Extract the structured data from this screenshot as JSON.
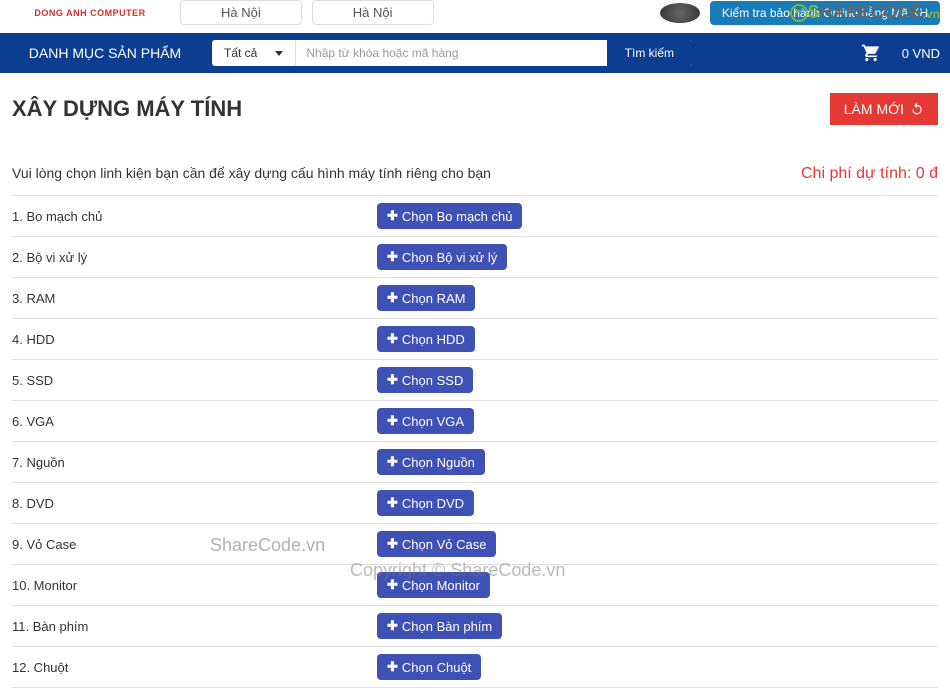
{
  "header": {
    "logo_text": "DONG ANH COMPUTER",
    "location1": "Hà Nội",
    "location2": "Hà Nội",
    "warranty_button": "Kiểm tra bảo hành Online bằng Mã KH"
  },
  "nav": {
    "category_label": "DANH MỤC SẢN PHẨM",
    "search_category": "Tất cả",
    "search_placeholder": "Nhập từ khóa hoặc mã hàng",
    "search_button": "Tìm kiếm",
    "cart_total": "0 VND"
  },
  "page": {
    "title": "XÂY DỰNG MÁY TÍNH",
    "reset_button": "LÀM MỚI",
    "instruction": "Vui lòng chọn linh kiện bạn cần để xây dựng cấu hình máy tính riêng cho bạn",
    "cost_label": "Chi phí dự tính: 0 đ"
  },
  "components": [
    {
      "index": "1.",
      "name": "Bo mạch chủ",
      "button": "Chọn Bo mạch chủ"
    },
    {
      "index": "2.",
      "name": "Bộ vi xử lý",
      "button": "Chọn Bộ vi xử lý"
    },
    {
      "index": "3.",
      "name": "RAM",
      "button": "Chọn RAM"
    },
    {
      "index": "4.",
      "name": "HDD",
      "button": "Chọn HDD"
    },
    {
      "index": "5.",
      "name": "SSD",
      "button": "Chọn SSD"
    },
    {
      "index": "6.",
      "name": "VGA",
      "button": "Chọn VGA"
    },
    {
      "index": "7.",
      "name": "Nguồn",
      "button": "Chọn Nguồn"
    },
    {
      "index": "8.",
      "name": "DVD",
      "button": "Chọn DVD"
    },
    {
      "index": "9.",
      "name": "Vỏ Case",
      "button": "Chọn Vỏ Case"
    },
    {
      "index": "10.",
      "name": "Monitor",
      "button": "Chọn Monitor"
    },
    {
      "index": "11.",
      "name": "Bàn phím",
      "button": "Chọn Bàn phím"
    },
    {
      "index": "12.",
      "name": "Chuột",
      "button": "Chọn Chuột"
    }
  ],
  "watermarks": {
    "w1": "ShareCode.vn",
    "w2": "Copyright © ShareCode.vn"
  }
}
